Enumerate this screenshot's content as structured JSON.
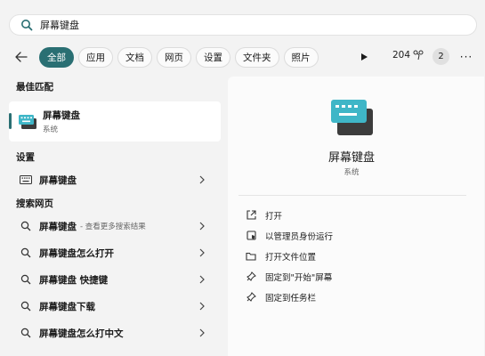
{
  "search": {
    "value": "屏幕键盘"
  },
  "filters": {
    "tabs": [
      "全部",
      "应用",
      "文档",
      "网页",
      "设置",
      "文件夹",
      "照片"
    ],
    "points": "204",
    "badge": "2",
    "more": "···"
  },
  "left": {
    "best_match_header": "最佳匹配",
    "best": {
      "title": "屏幕键盘",
      "subtitle": "系统"
    },
    "settings_header": "设置",
    "settings_item": "屏幕键盘",
    "web_header": "搜索网页",
    "web_items": [
      {
        "label": "屏幕键盘",
        "hint": "- 查看更多搜索结果"
      },
      {
        "label": "屏幕键盘怎么打开",
        "hint": ""
      },
      {
        "label": "屏幕键盘 快捷键",
        "hint": ""
      },
      {
        "label": "屏幕键盘下载",
        "hint": ""
      },
      {
        "label": "屏幕键盘怎么打中文",
        "hint": ""
      }
    ]
  },
  "right": {
    "title": "屏幕键盘",
    "subtitle": "系统",
    "actions": [
      "打开",
      "以管理员身份运行",
      "打开文件位置",
      "固定到\"开始\"屏幕",
      "固定到任务栏"
    ]
  },
  "colors": {
    "accent": "#2a6f73",
    "icon_teal": "#3fb6c7"
  }
}
